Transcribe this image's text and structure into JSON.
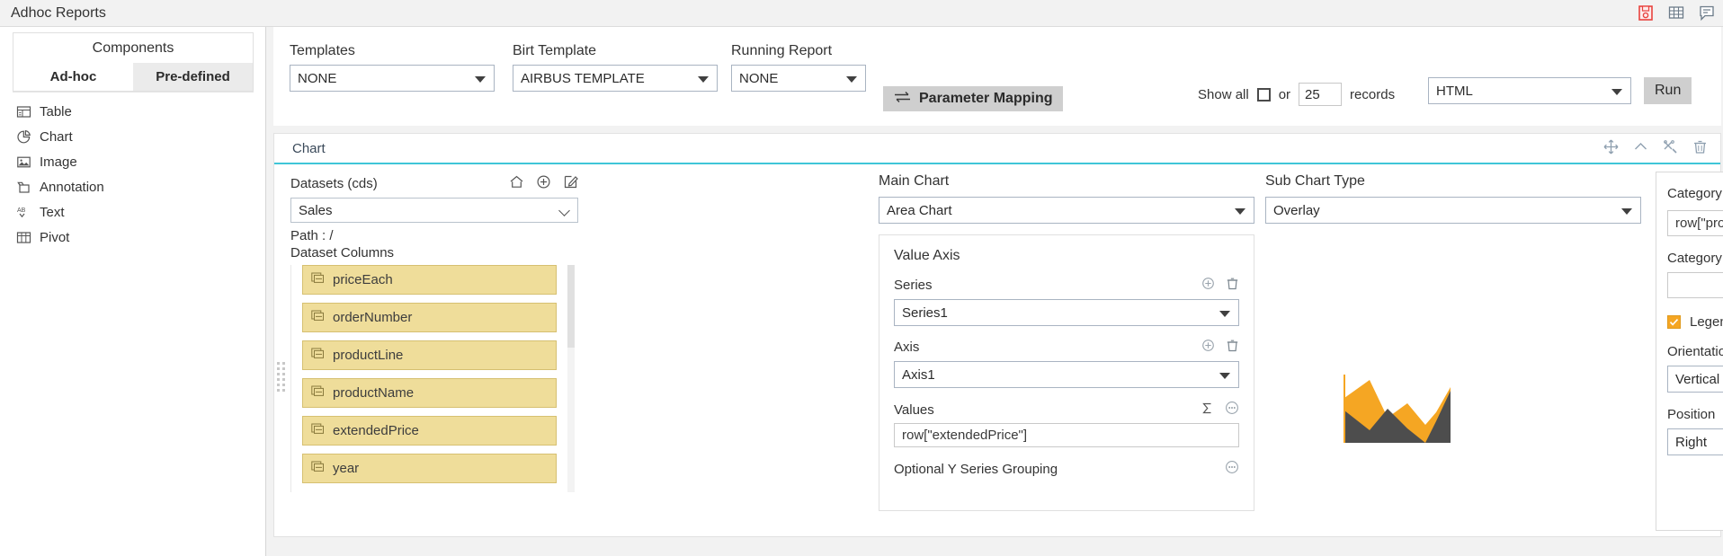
{
  "titlebar": {
    "app_title": "Adhoc Reports",
    "icons": [
      {
        "name": "save-icon",
        "label": "Save"
      },
      {
        "name": "grid-icon",
        "label": "Grid"
      },
      {
        "name": "comment-icon",
        "label": "Comment"
      }
    ]
  },
  "sidebar": {
    "header": "Components",
    "tabs": [
      {
        "label": "Ad-hoc",
        "active": true
      },
      {
        "label": "Pre-defined",
        "active": false
      }
    ],
    "items": [
      {
        "label": "Table",
        "icon": "table-icon"
      },
      {
        "label": "Chart",
        "icon": "chart-icon"
      },
      {
        "label": "Image",
        "icon": "image-icon"
      },
      {
        "label": "Annotation",
        "icon": "annotation-icon"
      },
      {
        "label": "Text",
        "icon": "text-icon"
      },
      {
        "label": "Pivot",
        "icon": "pivot-icon"
      }
    ]
  },
  "toolbar": {
    "templates_label": "Templates",
    "templates_value": "NONE",
    "birt_label": "Birt Template",
    "birt_value": "AIRBUS TEMPLATE",
    "running_label": "Running Report",
    "running_value": "NONE",
    "parameter_mapping_label": "Parameter Mapping",
    "show_all_label": "Show all",
    "or_label": "or",
    "records_value": "25",
    "records_label": "records",
    "format_value": "HTML",
    "run_label": "Run"
  },
  "chart_card": {
    "title": "Chart",
    "tools": [
      {
        "name": "move-icon"
      },
      {
        "name": "chevron-up-icon"
      },
      {
        "name": "settings-tools-icon"
      },
      {
        "name": "delete-icon"
      }
    ],
    "datasets": {
      "header": "Datasets (cds)",
      "icons": [
        {
          "name": "home-icon"
        },
        {
          "name": "plus-circle-icon"
        },
        {
          "name": "edit-icon"
        }
      ],
      "selected": "Sales",
      "path": "Path : /",
      "columns_label": "Dataset Columns",
      "columns": [
        "priceEach",
        "orderNumber",
        "productLine",
        "productName",
        "extendedPrice",
        "year"
      ]
    },
    "main_chart": {
      "label": "Main Chart",
      "value": "Area Chart",
      "value_axis_label": "Value Axis",
      "series_label": "Series",
      "series_value": "Series1",
      "axis_label": "Axis",
      "axis_value": "Axis1",
      "values_label": "Values",
      "values_value": "row[\"extendedPrice\"]",
      "optional_grouping_label": "Optional Y Series Grouping"
    },
    "sub_chart": {
      "label": "Sub Chart Type",
      "value": "Overlay",
      "preview_colors": {
        "area_primary": "#f5a623",
        "area_secondary": "#4d4d4d"
      }
    },
    "category": {
      "header": "Category (X) Series",
      "x_series_value": "row[\"productLine\"]",
      "category_axis_label": "Category Axis",
      "category_axis_value": "",
      "legend_enable_label": "Legend Enable",
      "legend_enabled": true,
      "orientation_label": "Orientation",
      "orientation_value": "Vertical",
      "position_label": "Position",
      "position_value": "Right"
    }
  },
  "colors": {
    "accent_cyan": "#3fc6d8",
    "chip_yellow": "#efdd9a",
    "orange": "#f5a623"
  }
}
